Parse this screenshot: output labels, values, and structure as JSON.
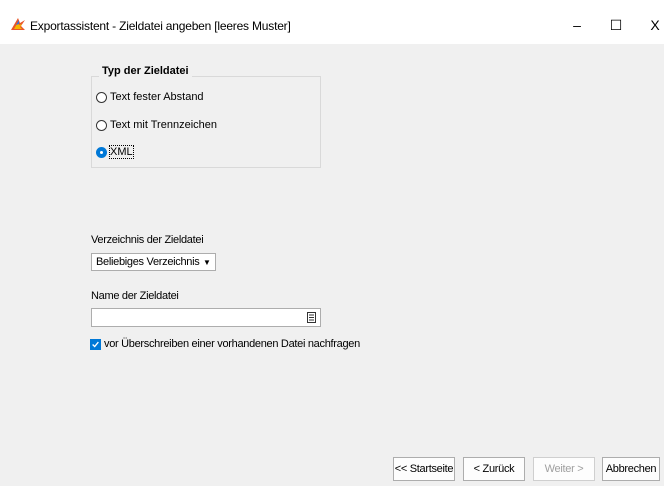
{
  "window": {
    "title": "Exportassistent - Zieldatei angeben [leeres Muster]",
    "minimize_glyph": "–",
    "maximize_glyph": "☐",
    "close_glyph": "X",
    "icon": "app-export-icon"
  },
  "target_type": {
    "legend": "Typ der Zieldatei",
    "options": [
      {
        "label": "Text fester Abstand",
        "checked": false
      },
      {
        "label": "Text mit Trennzeichen",
        "checked": false
      },
      {
        "label": "XML",
        "checked": true
      }
    ]
  },
  "directory": {
    "label": "Verzeichnis der Zieldatei",
    "value": "Beliebiges Verzeichnis",
    "arrow_glyph": "▼"
  },
  "filename": {
    "label": "Name der Zieldatei",
    "value": "",
    "browse_icon": "browse-file-icon"
  },
  "overwrite": {
    "label": "vor Überschreiben einer vorhandenen Datei nachfragen",
    "checked": true
  },
  "buttons": {
    "start": "<< Startseite",
    "back": "< Zurück",
    "next": "Weiter >",
    "cancel": "Abbrechen"
  },
  "colors": {
    "accent": "#0078d7",
    "background": "#f0f0f0"
  }
}
